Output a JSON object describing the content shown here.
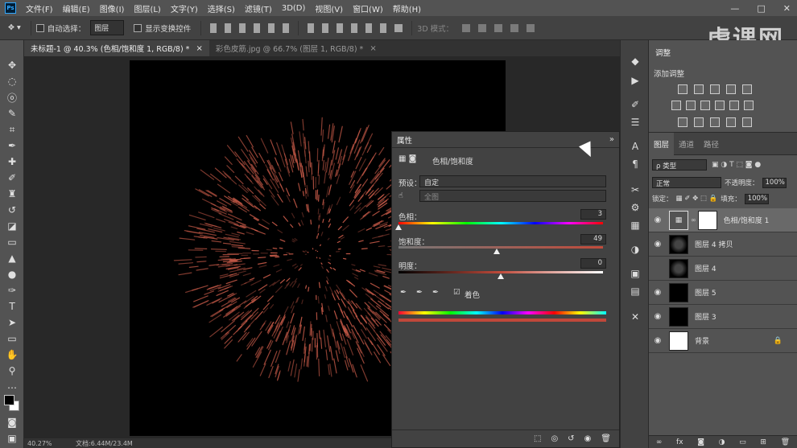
{
  "app": {
    "logo": "Ps"
  },
  "menu": [
    "文件(F)",
    "编辑(E)",
    "图像(I)",
    "图层(L)",
    "文字(Y)",
    "选择(S)",
    "滤镜(T)",
    "3D(D)",
    "视图(V)",
    "窗口(W)",
    "帮助(H)"
  ],
  "window_controls": [
    "—",
    "□",
    "✕"
  ],
  "options": {
    "auto_select_label": "自动选择：",
    "auto_select_value": "图层",
    "show_transform_label": "显示变换控件",
    "mode_3d_label": "3D 模式："
  },
  "watermark": "虎课网",
  "tabs": [
    {
      "label": "未标题-1 @ 40.3% (色相/饱和度 1, RGB/8) *",
      "close": "×"
    },
    {
      "label": "彩色皮筋.jpg @ 66.7% (图层 1, RGB/8) *",
      "close": "×"
    }
  ],
  "status": {
    "zoom": "40.27%",
    "doc": "文档:6.44M/23.4M"
  },
  "properties": {
    "title": "属性",
    "adjustment_name": "色相/饱和度",
    "preset_label": "预设：",
    "preset_value": "自定",
    "channel_value": "全图",
    "hue_label": "色相：",
    "hue_value": "3",
    "saturation_label": "饱和度：",
    "saturation_value": "49",
    "lightness_label": "明度：",
    "lightness_value": "0",
    "colorize_label": "着色",
    "colorize_checked": true,
    "slider_fractions": {
      "hue": 0.0,
      "saturation": 0.48,
      "lightness": 0.5
    }
  },
  "adjustments": {
    "tab_label": "调整",
    "add_label": "添加调整"
  },
  "layers_panel": {
    "tabs": [
      "图层",
      "通道",
      "路径"
    ],
    "filter_value": "ρ 类型",
    "blend_mode": "正常",
    "opacity_label": "不透明度：",
    "opacity_value": "100%",
    "lock_label": "锁定：",
    "fill_label": "填充：",
    "fill_value": "100%",
    "layers": [
      {
        "name": "色相/饱和度 1",
        "visible": true,
        "selected": true,
        "thumb": "adjust"
      },
      {
        "name": "图层 4 拷贝",
        "visible": true,
        "selected": false,
        "thumb": "ball"
      },
      {
        "name": "图层 4",
        "visible": false,
        "selected": false,
        "thumb": "ball"
      },
      {
        "name": "图层 5",
        "visible": true,
        "selected": false,
        "thumb": "black"
      },
      {
        "name": "图层 3",
        "visible": true,
        "selected": false,
        "thumb": "black"
      },
      {
        "name": "背景",
        "visible": true,
        "selected": false,
        "thumb": "white",
        "locked": true
      }
    ]
  },
  "colors": {
    "firework": "#c75a48",
    "panel": "#535353",
    "dark_panel": "#424242"
  }
}
